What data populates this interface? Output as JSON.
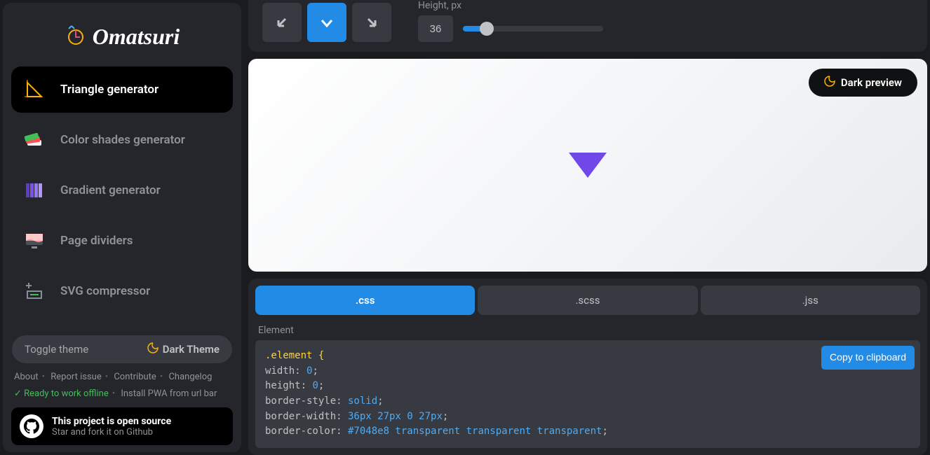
{
  "brand": {
    "name": "Omatsuri"
  },
  "sidebar": {
    "items": [
      {
        "label": "Triangle generator",
        "active": true
      },
      {
        "label": "Color shades generator",
        "active": false
      },
      {
        "label": "Gradient generator",
        "active": false
      },
      {
        "label": "Page dividers",
        "active": false
      },
      {
        "label": "SVG compressor",
        "active": false
      }
    ]
  },
  "theme_toggle": {
    "label": "Toggle theme",
    "current": "Dark Theme"
  },
  "footer": {
    "about": "About",
    "report": "Report issue",
    "contribute": "Contribute",
    "changelog": "Changelog",
    "offline": "Ready to work offline",
    "install": "Install PWA from url bar"
  },
  "opensource": {
    "headline": "This project is open source",
    "sub": "Star and fork it on Github"
  },
  "controls": {
    "height_label": "Height, px",
    "height_value": "36"
  },
  "preview_btn": "Dark preview",
  "tabs": {
    "css": ".css",
    "scss": ".scss",
    "jss": ".jss"
  },
  "code": {
    "section_label": "Element",
    "copy_label": "Copy to clipboard",
    "lines": {
      "l1": ".element {",
      "l2a": "  width:",
      "l2b": " 0",
      "l2c": ";",
      "l3a": "  height:",
      "l3b": " 0",
      "l3c": ";",
      "l4a": "  border-style:",
      "l4b": " solid",
      "l4c": ";",
      "l5a": "  border-width:",
      "l5b": " 36px 27px 0 27px",
      "l5c": ";",
      "l6a": "  border-color:",
      "l6b": " #7048e8 transparent transparent transparent",
      "l6c": ";"
    }
  },
  "triangle_color": "#7048e8"
}
